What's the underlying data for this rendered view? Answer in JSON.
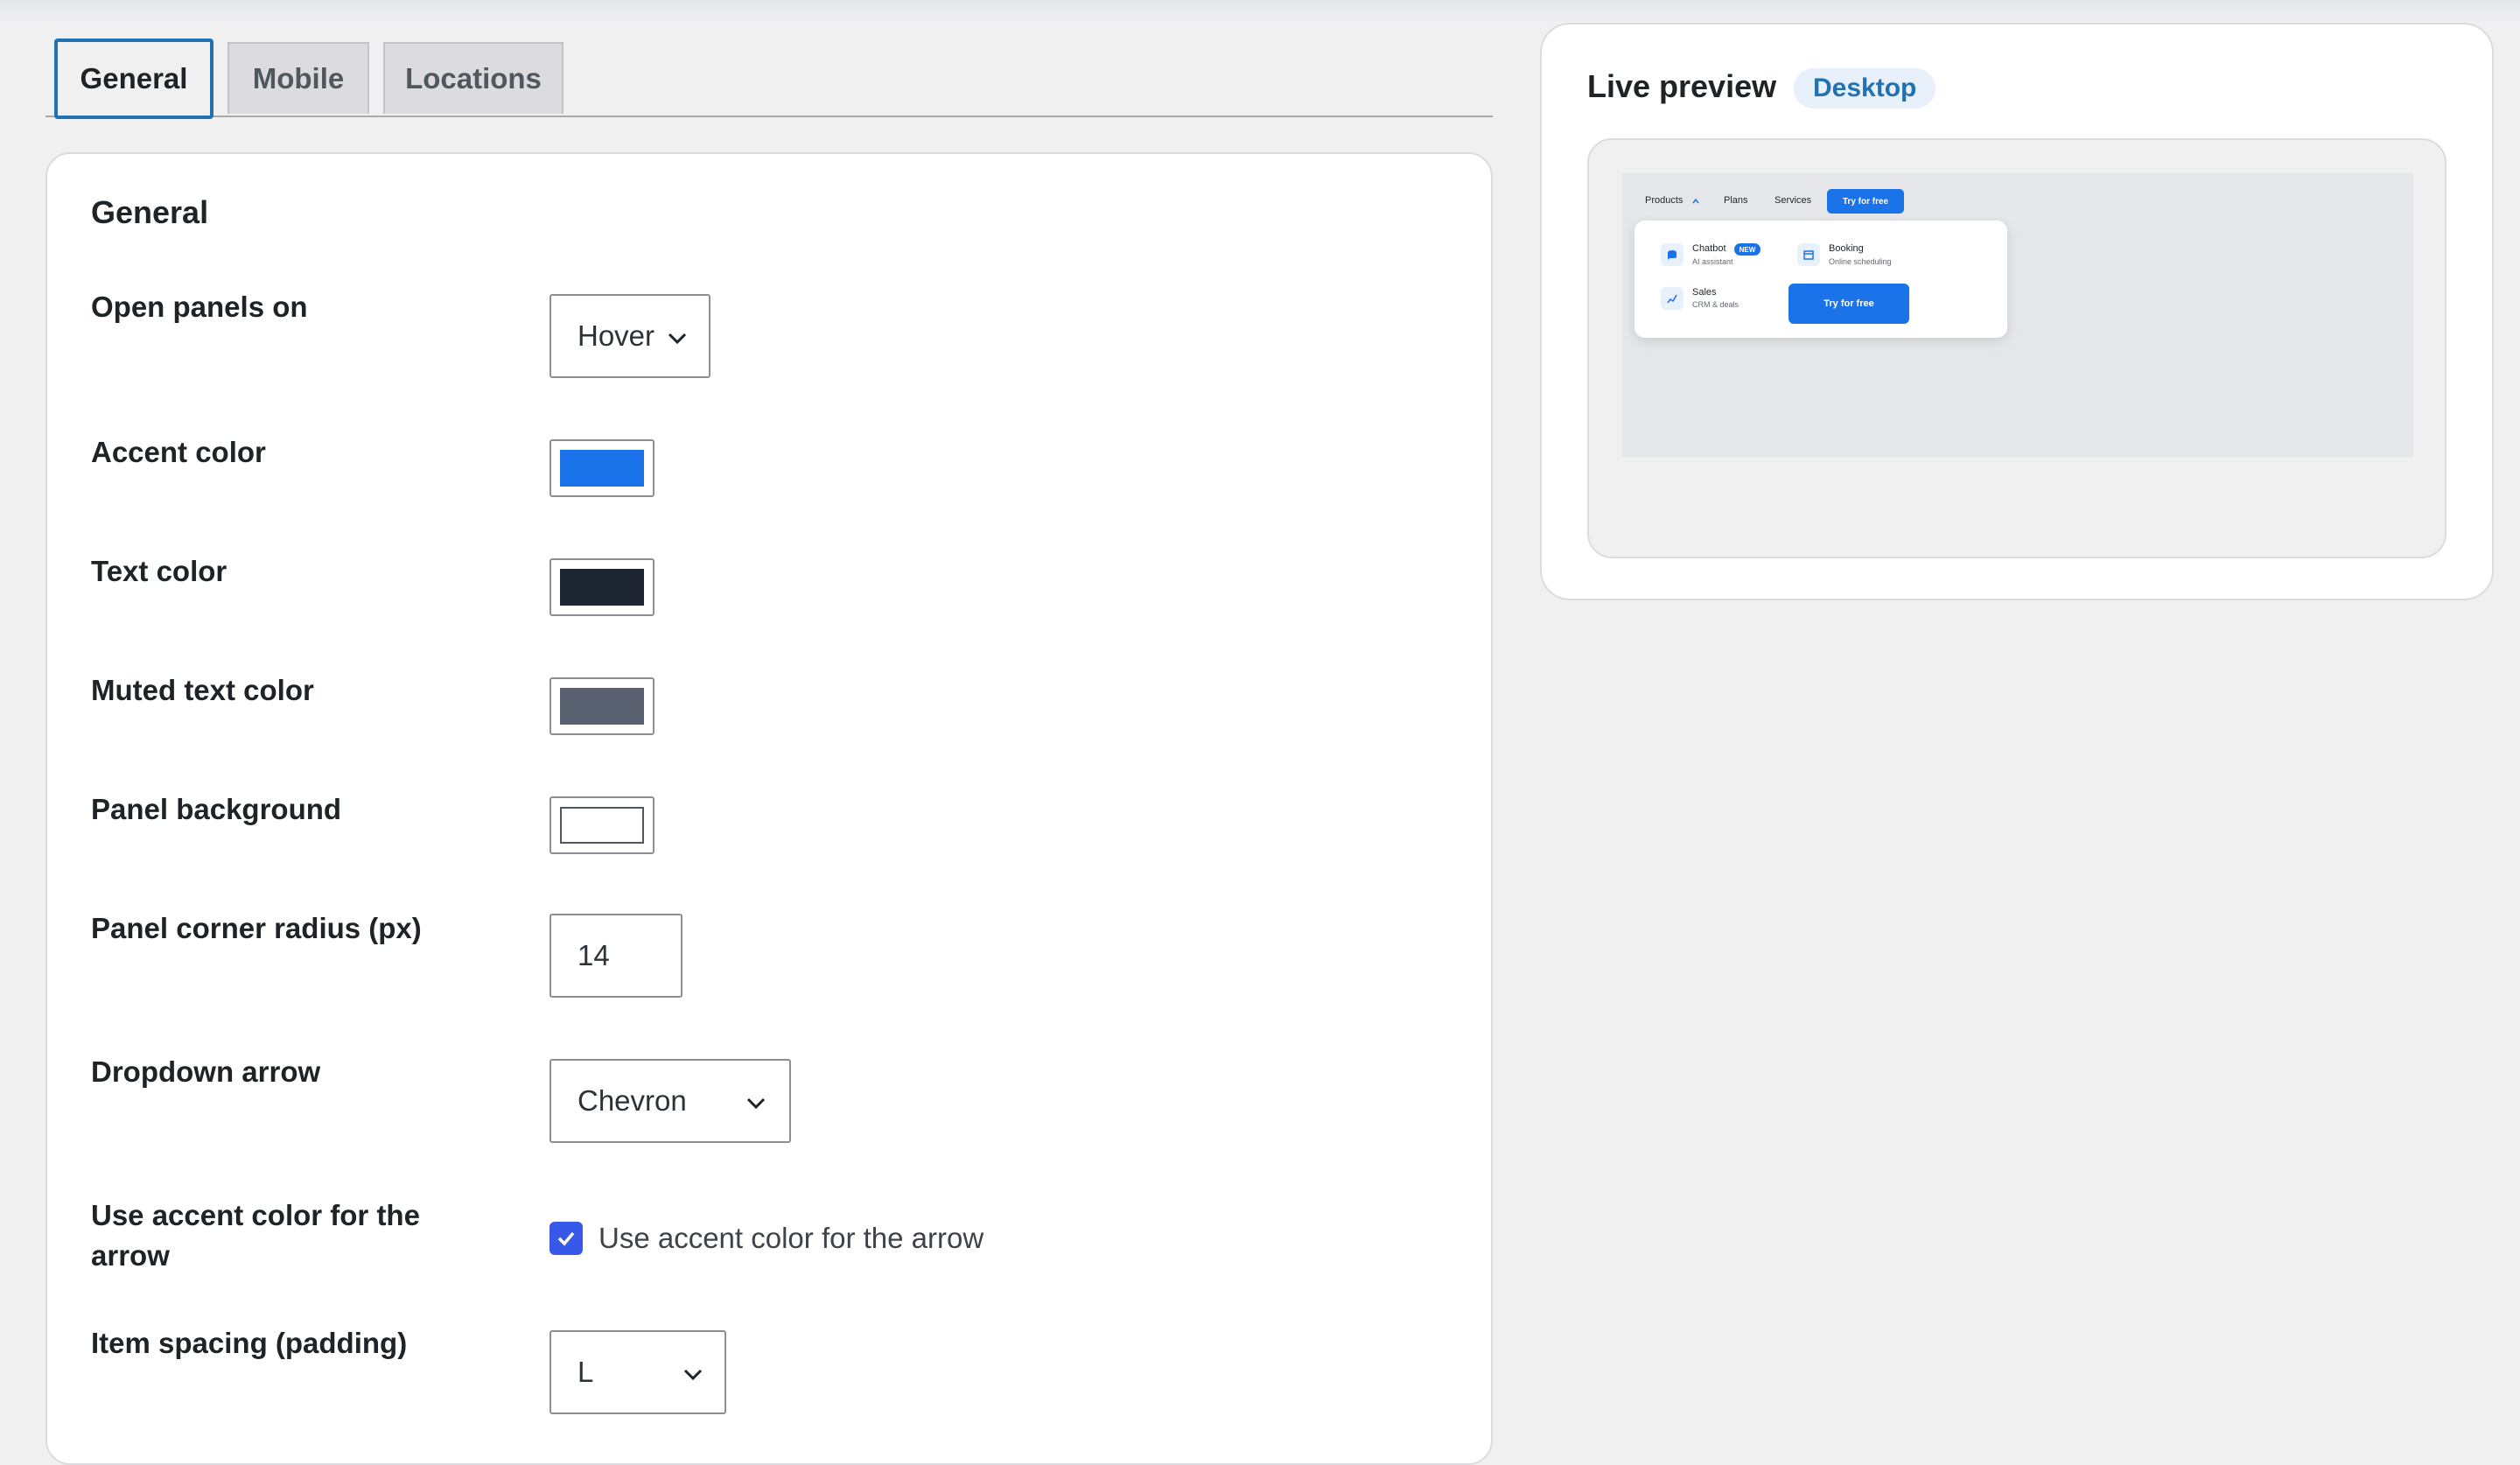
{
  "tabs": [
    {
      "label": "General",
      "active": true
    },
    {
      "label": "Mobile",
      "active": false
    },
    {
      "label": "Locations",
      "active": false
    }
  ],
  "section": {
    "title": "General",
    "fields": {
      "open_panels": {
        "label": "Open panels on",
        "value": "Hover"
      },
      "accent_color": {
        "label": "Accent color",
        "color": "#1a73e8"
      },
      "text_color": {
        "label": "Text color",
        "color": "#1d2632"
      },
      "muted_text_color": {
        "label": "Muted text color",
        "color": "#5a6170"
      },
      "panel_background": {
        "label": "Panel background",
        "color": "#ffffff"
      },
      "panel_corner_radius": {
        "label": "Panel corner radius (px)",
        "value": "14"
      },
      "dropdown_arrow": {
        "label": "Dropdown arrow",
        "value": "Chevron"
      },
      "use_accent_arrow": {
        "label": "Use accent color for the arrow",
        "checkbox_label": "Use accent color for the arrow",
        "checked": true
      },
      "item_spacing": {
        "label": "Item spacing (padding)",
        "value": "L"
      }
    }
  },
  "preview": {
    "title": "Live preview",
    "badge": "Desktop",
    "mini": {
      "nav": [
        "Products",
        "Plans",
        "Services"
      ],
      "nav_button": "Try for free",
      "items": [
        {
          "title": "Chatbot",
          "subtitle": "AI assistant",
          "badge": "NEW",
          "icon": "chat-icon"
        },
        {
          "title": "Booking",
          "subtitle": "Online scheduling",
          "icon": "calendar-icon"
        },
        {
          "title": "Sales",
          "subtitle": "CRM & deals",
          "icon": "chart-icon"
        }
      ],
      "cta": "Try for free"
    }
  }
}
